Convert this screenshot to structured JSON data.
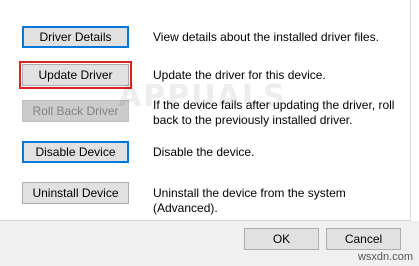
{
  "buttons": {
    "driver_details": "Driver Details",
    "update_driver": "Update Driver",
    "roll_back_driver": "Roll Back Driver",
    "disable_device": "Disable Device",
    "uninstall_device": "Uninstall Device"
  },
  "descriptions": {
    "driver_details": "View details about the installed driver files.",
    "update_driver": "Update the driver for this device.",
    "roll_back_driver": "If the device fails after updating the driver, roll back to the previously installed driver.",
    "disable_device": "Disable the device.",
    "uninstall_device": "Uninstall the device from the system (Advanced)."
  },
  "footer": {
    "ok_label": "OK",
    "cancel_label": "Cancel"
  },
  "watermark": {
    "logo_text": "APPUALS",
    "site_text": "wsxdn.com"
  },
  "colors": {
    "highlight": "#d9251d",
    "focus": "#0078d7"
  }
}
